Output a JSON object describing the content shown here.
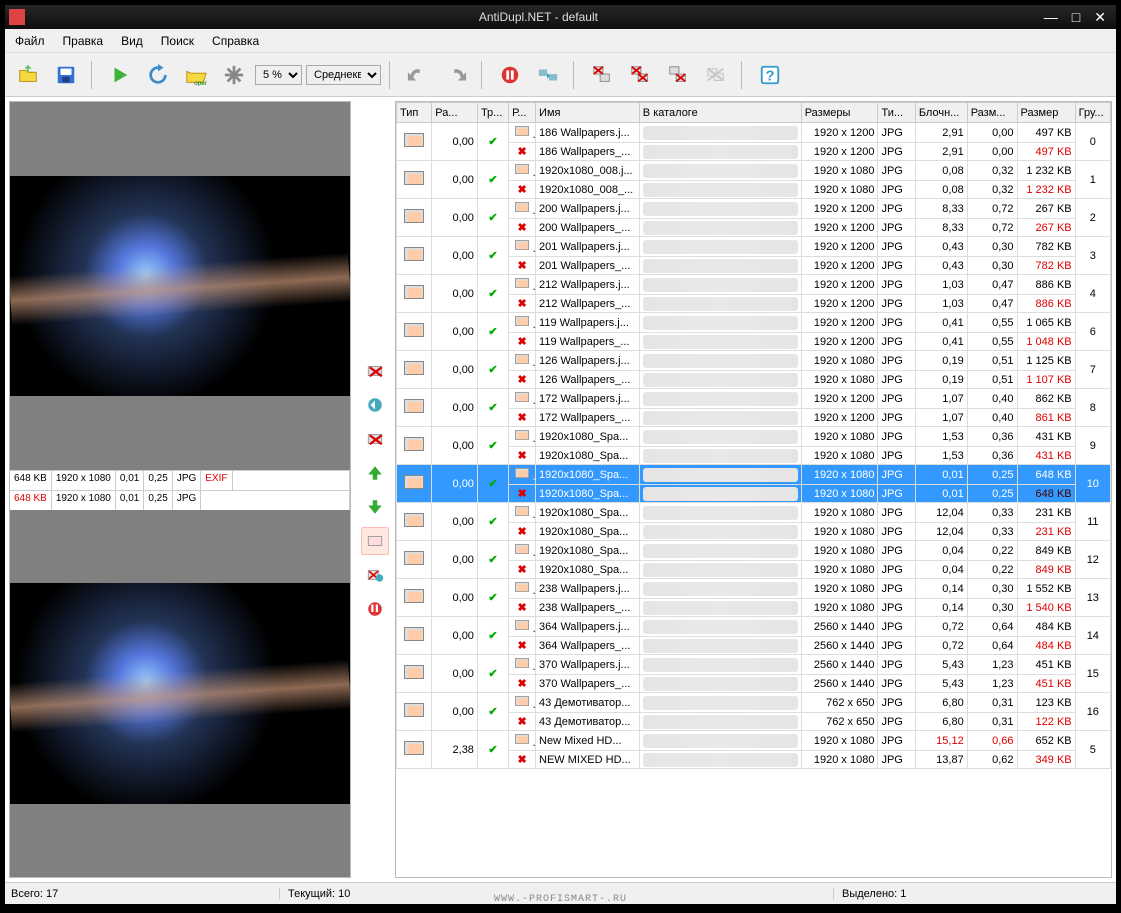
{
  "window": {
    "title": "AntiDupl.NET - default"
  },
  "menu": {
    "file": "Файл",
    "edit": "Правка",
    "view": "Вид",
    "search": "Поиск",
    "help": "Справка"
  },
  "toolbar": {
    "zoom": "5 %",
    "algo": "Среднекв..."
  },
  "left": {
    "top": {
      "size": "648 KB",
      "dim": "1920 x 1080",
      "d1": "0,01",
      "d2": "0,25",
      "fmt": "JPG",
      "exif": "EXIF"
    },
    "bottom": {
      "size": "648 KB",
      "dim": "1920 x 1080",
      "d1": "0,01",
      "d2": "0,25",
      "fmt": "JPG"
    }
  },
  "columns": {
    "type": "Тип",
    "ra": "Ра...",
    "tr": "Тр...",
    "r": "Р...",
    "name": "Имя",
    "catalog": "В каталоге",
    "dim": "Размеры",
    "ti": "Ти...",
    "block": "Блочн...",
    "razm": "Разм...",
    "size": "Размер",
    "grp": "Гру..."
  },
  "rows": [
    {
      "g": 0,
      "d": "0,00",
      "a": {
        "n": "186 Wallpapers.j...",
        "dim": "1920 x 1200",
        "t": "JPG",
        "b": "2,91",
        "r": "0,00",
        "s": "497 KB"
      },
      "b": {
        "n": "186 Wallpapers_...",
        "dim": "1920 x 1200",
        "t": "JPG",
        "b": "2,91",
        "r": "0,00",
        "s": "497 KB",
        "red": true
      }
    },
    {
      "g": 1,
      "d": "0,00",
      "a": {
        "n": "1920x1080_008.j...",
        "dim": "1920 x 1080",
        "t": "JPG",
        "b": "0,08",
        "r": "0,32",
        "s": "1 232 KB"
      },
      "b": {
        "n": "1920x1080_008_...",
        "dim": "1920 x 1080",
        "t": "JPG",
        "b": "0,08",
        "r": "0,32",
        "s": "1 232 KB",
        "red": true
      }
    },
    {
      "g": 2,
      "d": "0,00",
      "a": {
        "n": "200 Wallpapers.j...",
        "dim": "1920 x 1200",
        "t": "JPG",
        "b": "8,33",
        "r": "0,72",
        "s": "267 KB"
      },
      "b": {
        "n": "200 Wallpapers_...",
        "dim": "1920 x 1200",
        "t": "JPG",
        "b": "8,33",
        "r": "0,72",
        "s": "267 KB",
        "red": true
      }
    },
    {
      "g": 3,
      "d": "0,00",
      "a": {
        "n": "201 Wallpapers.j...",
        "dim": "1920 x 1200",
        "t": "JPG",
        "b": "0,43",
        "r": "0,30",
        "s": "782 KB"
      },
      "b": {
        "n": "201 Wallpapers_...",
        "dim": "1920 x 1200",
        "t": "JPG",
        "b": "0,43",
        "r": "0,30",
        "s": "782 KB",
        "red": true
      }
    },
    {
      "g": 4,
      "d": "0,00",
      "a": {
        "n": "212 Wallpapers.j...",
        "dim": "1920 x 1200",
        "t": "JPG",
        "b": "1,03",
        "r": "0,47",
        "s": "886 KB"
      },
      "b": {
        "n": "212 Wallpapers_...",
        "dim": "1920 x 1200",
        "t": "JPG",
        "b": "1,03",
        "r": "0,47",
        "s": "886 KB",
        "red": true
      }
    },
    {
      "g": 6,
      "d": "0,00",
      "a": {
        "n": "119 Wallpapers.j...",
        "dim": "1920 x 1200",
        "t": "JPG",
        "b": "0,41",
        "r": "0,55",
        "s": "1 065 KB"
      },
      "b": {
        "n": "119 Wallpapers_...",
        "dim": "1920 x 1200",
        "t": "JPG",
        "b": "0,41",
        "r": "0,55",
        "s": "1 048 KB",
        "red": true
      }
    },
    {
      "g": 7,
      "d": "0,00",
      "a": {
        "n": "126 Wallpapers.j...",
        "dim": "1920 x 1080",
        "t": "JPG",
        "b": "0,19",
        "r": "0,51",
        "s": "1 125 KB"
      },
      "b": {
        "n": "126 Wallpapers_...",
        "dim": "1920 x 1080",
        "t": "JPG",
        "b": "0,19",
        "r": "0,51",
        "s": "1 107 KB",
        "red": true
      }
    },
    {
      "g": 8,
      "d": "0,00",
      "a": {
        "n": "172 Wallpapers.j...",
        "dim": "1920 x 1200",
        "t": "JPG",
        "b": "1,07",
        "r": "0,40",
        "s": "862 KB"
      },
      "b": {
        "n": "172 Wallpapers_...",
        "dim": "1920 x 1200",
        "t": "JPG",
        "b": "1,07",
        "r": "0,40",
        "s": "861 KB",
        "red": true
      }
    },
    {
      "g": 9,
      "d": "0,00",
      "a": {
        "n": "1920x1080_Spa...",
        "dim": "1920 x 1080",
        "t": "JPG",
        "b": "1,53",
        "r": "0,36",
        "s": "431 KB"
      },
      "b": {
        "n": "1920x1080_Spa...",
        "dim": "1920 x 1080",
        "t": "JPG",
        "b": "1,53",
        "r": "0,36",
        "s": "431 KB",
        "red": true
      }
    },
    {
      "g": 10,
      "d": "0,00",
      "sel": true,
      "a": {
        "n": "1920x1080_Spa...",
        "dim": "1920 x 1080",
        "t": "JPG",
        "b": "0,01",
        "r": "0,25",
        "s": "648 KB"
      },
      "b": {
        "n": "1920x1080_Spa...",
        "dim": "1920 x 1080",
        "t": "JPG",
        "b": "0,01",
        "r": "0,25",
        "s": "648 KB",
        "red": true
      }
    },
    {
      "g": 11,
      "d": "0,00",
      "a": {
        "n": "1920x1080_Spa...",
        "dim": "1920 x 1080",
        "t": "JPG",
        "b": "12,04",
        "r": "0,33",
        "s": "231 KB"
      },
      "b": {
        "n": "1920x1080_Spa...",
        "dim": "1920 x 1080",
        "t": "JPG",
        "b": "12,04",
        "r": "0,33",
        "s": "231 KB",
        "red": true
      }
    },
    {
      "g": 12,
      "d": "0,00",
      "a": {
        "n": "1920x1080_Spa...",
        "dim": "1920 x 1080",
        "t": "JPG",
        "b": "0,04",
        "r": "0,22",
        "s": "849 KB"
      },
      "b": {
        "n": "1920x1080_Spa...",
        "dim": "1920 x 1080",
        "t": "JPG",
        "b": "0,04",
        "r": "0,22",
        "s": "849 KB",
        "red": true
      }
    },
    {
      "g": 13,
      "d": "0,00",
      "a": {
        "n": "238 Wallpapers.j...",
        "dim": "1920 x 1080",
        "t": "JPG",
        "b": "0,14",
        "r": "0,30",
        "s": "1 552 KB"
      },
      "b": {
        "n": "238 Wallpapers_...",
        "dim": "1920 x 1080",
        "t": "JPG",
        "b": "0,14",
        "r": "0,30",
        "s": "1 540 KB",
        "red": true
      }
    },
    {
      "g": 14,
      "d": "0,00",
      "a": {
        "n": "364 Wallpapers.j...",
        "dim": "2560 x 1440",
        "t": "JPG",
        "b": "0,72",
        "r": "0,64",
        "s": "484 KB"
      },
      "b": {
        "n": "364 Wallpapers_...",
        "dim": "2560 x 1440",
        "t": "JPG",
        "b": "0,72",
        "r": "0,64",
        "s": "484 KB",
        "red": true
      }
    },
    {
      "g": 15,
      "d": "0,00",
      "a": {
        "n": "370 Wallpapers.j...",
        "dim": "2560 x 1440",
        "t": "JPG",
        "b": "5,43",
        "r": "1,23",
        "s": "451 KB"
      },
      "b": {
        "n": "370 Wallpapers_...",
        "dim": "2560 x 1440",
        "t": "JPG",
        "b": "5,43",
        "r": "1,23",
        "s": "451 KB",
        "red": true
      }
    },
    {
      "g": 16,
      "d": "0,00",
      "a": {
        "n": "43 Демотиватор...",
        "dim": "762 x 650",
        "t": "JPG",
        "b": "6,80",
        "r": "0,31",
        "s": "123 KB"
      },
      "b": {
        "n": "43 Демотиватор...",
        "dim": "762 x 650",
        "t": "JPG",
        "b": "6,80",
        "r": "0,31",
        "s": "122 KB",
        "red": true
      }
    },
    {
      "g": 5,
      "d": "2,38",
      "a": {
        "n": "New Mixed HD...",
        "dim": "1920 x 1080",
        "t": "JPG",
        "b": "15,12",
        "bred": true,
        "r": "0,66",
        "rred": true,
        "s": "652 KB"
      },
      "b": {
        "n": "NEW MIXED HD...",
        "dim": "1920 x 1080",
        "t": "JPG",
        "b": "13,87",
        "r": "0,62",
        "s": "349 KB",
        "red": true
      }
    }
  ],
  "status": {
    "total": "Всего: 17",
    "current": "Текущий: 10",
    "selected": "Выделено: 1",
    "watermark": "WWW.-PROFISMART-.RU"
  }
}
